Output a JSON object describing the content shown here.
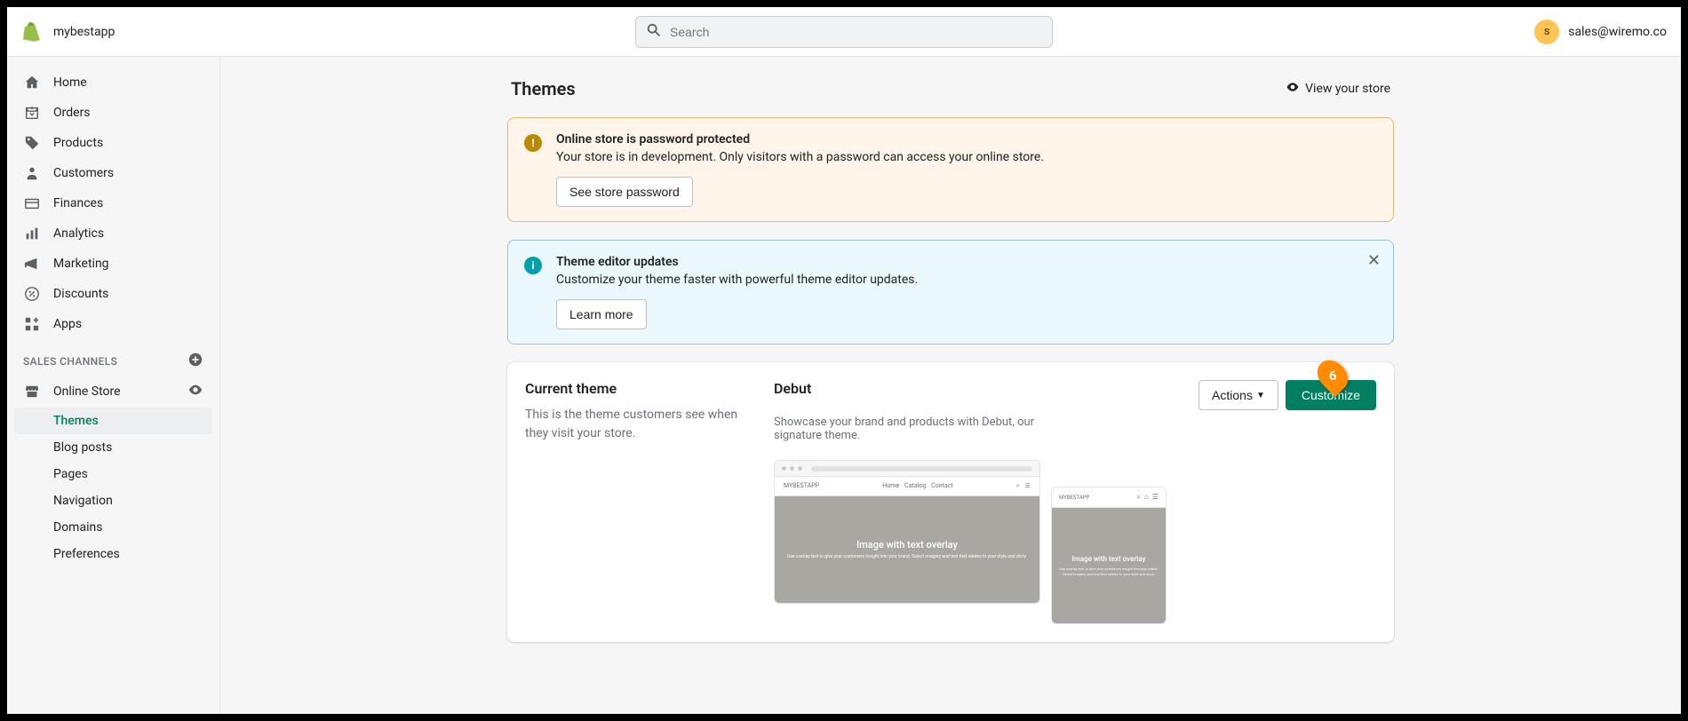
{
  "topbar": {
    "store_name": "mybestapp",
    "search_placeholder": "Search",
    "avatar_initial": "s",
    "user_email": "sales@wiremo.co"
  },
  "sidebar": {
    "items": [
      {
        "label": "Home"
      },
      {
        "label": "Orders"
      },
      {
        "label": "Products"
      },
      {
        "label": "Customers"
      },
      {
        "label": "Finances"
      },
      {
        "label": "Analytics"
      },
      {
        "label": "Marketing"
      },
      {
        "label": "Discounts"
      },
      {
        "label": "Apps"
      }
    ],
    "channels_header": "SALES CHANNELS",
    "channel": {
      "label": "Online Store"
    },
    "sub_items": [
      {
        "label": "Themes",
        "active": true
      },
      {
        "label": "Blog posts"
      },
      {
        "label": "Pages"
      },
      {
        "label": "Navigation"
      },
      {
        "label": "Domains"
      },
      {
        "label": "Preferences"
      }
    ]
  },
  "page": {
    "title": "Themes",
    "view_store": "View your store"
  },
  "banner_warn": {
    "title": "Online store is password protected",
    "text": "Your store is in development. Only visitors with a password can access your online store.",
    "button": "See store password"
  },
  "banner_info": {
    "title": "Theme editor updates",
    "text": "Customize your theme faster with powerful theme editor updates.",
    "button": "Learn more"
  },
  "current_theme": {
    "section_title": "Current theme",
    "section_desc": "This is the theme customers see when they visit your store.",
    "name": "Debut",
    "desc": "Showcase your brand and products with Debut, our signature theme.",
    "actions_label": "Actions",
    "customize_label": "Customize",
    "marker_number": "6",
    "preview": {
      "brand": "MYBESTAPP",
      "hero_title": "Image with text overlay",
      "hero_sub_desktop": "Use overlay text to give your customers insight into your brand. Select imagery and text that relates to your style and story.",
      "hero_sub_mobile": "Use overlay text to give your customers insight into your brand. Select imagery and text that relates to your style and story."
    }
  }
}
